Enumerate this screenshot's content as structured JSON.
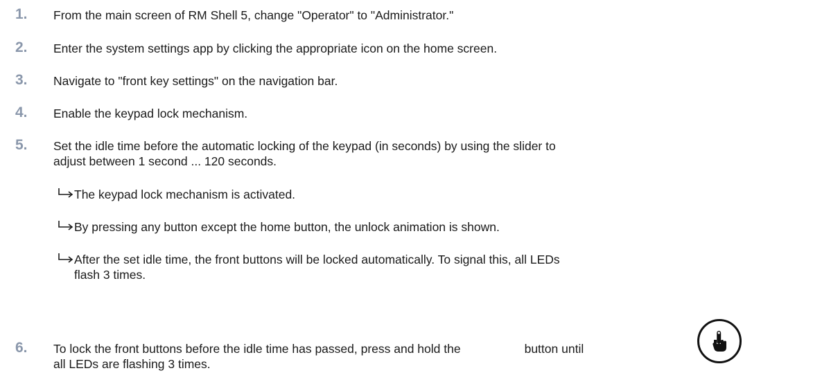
{
  "steps": [
    {
      "num": "1.",
      "text": "From the main screen of RM Shell 5, change \"Operator\" to \"Administrator.\""
    },
    {
      "num": "2.",
      "text": "Enter the system settings app by clicking the appropriate icon on the home screen."
    },
    {
      "num": "3.",
      "text": "Navigate to \"front key settings\" on the navigation bar."
    },
    {
      "num": "4.",
      "text": "Enable the keypad lock mechanism."
    },
    {
      "num": "5.",
      "text_line1": "Set the idle time before the automatic locking of the keypad (in seconds) by using the slider to",
      "text_line2": "adjust between 1 second ... 120 seconds."
    },
    {
      "num": "6.",
      "text_before": "To lock the front buttons before the idle time has passed, press and hold the",
      "text_after": "button until",
      "text_line2": "all LEDs are flashing 3 times."
    }
  ],
  "results": [
    {
      "text": "The keypad lock mechanism is activated."
    },
    {
      "text": "By pressing any button except the home button, the unlock animation is shown."
    },
    {
      "text_line1": "After the set idle time, the front buttons will be locked automatically. To signal this, all LEDs",
      "text_line2": "flash 3 times."
    }
  ],
  "icons": {
    "result_arrow": "result-arrow-icon",
    "lock_button": "press-button-icon"
  }
}
